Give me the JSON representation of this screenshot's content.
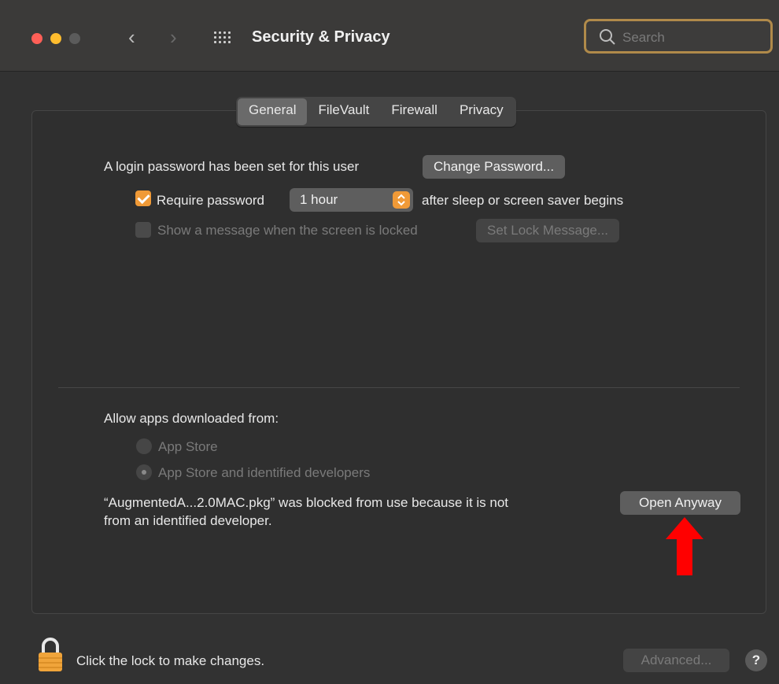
{
  "window": {
    "title": "Security & Privacy"
  },
  "search": {
    "placeholder": "Search"
  },
  "tabs": [
    "General",
    "FileVault",
    "Firewall",
    "Privacy"
  ],
  "active_tab": "General",
  "general": {
    "login_password_text": "A login password has been set for this user",
    "change_password_button": "Change Password...",
    "require_password": {
      "checked": true,
      "label": "Require password",
      "selected_option": "1 hour",
      "suffix": "after sleep or screen saver begins"
    },
    "show_message": {
      "checked": false,
      "label": "Show a message when the screen is locked",
      "button": "Set Lock Message..."
    }
  },
  "allow_apps": {
    "heading": "Allow apps downloaded from:",
    "options": [
      "App Store",
      "App Store and identified developers"
    ],
    "selected_index": 1,
    "blocked_line1": "“AugmentedA...2.0MAC.pkg” was blocked from use because it is not",
    "blocked_line2": "from an identified developer.",
    "open_anyway_button": "Open Anyway"
  },
  "footer": {
    "lock_text": "Click the lock to make changes.",
    "advanced_button": "Advanced...",
    "help_label": "?"
  },
  "colors": {
    "accent": "#f09a37",
    "search_highlight": "#b08a4a",
    "annotation_arrow": "#ff0000"
  },
  "icons": [
    "close-window-icon",
    "minimize-window-icon",
    "zoom-window-icon",
    "back-icon",
    "forward-icon",
    "show-all-grid-icon",
    "search-icon",
    "up-arrow-annotation-icon",
    "lock-icon",
    "help-icon"
  ]
}
